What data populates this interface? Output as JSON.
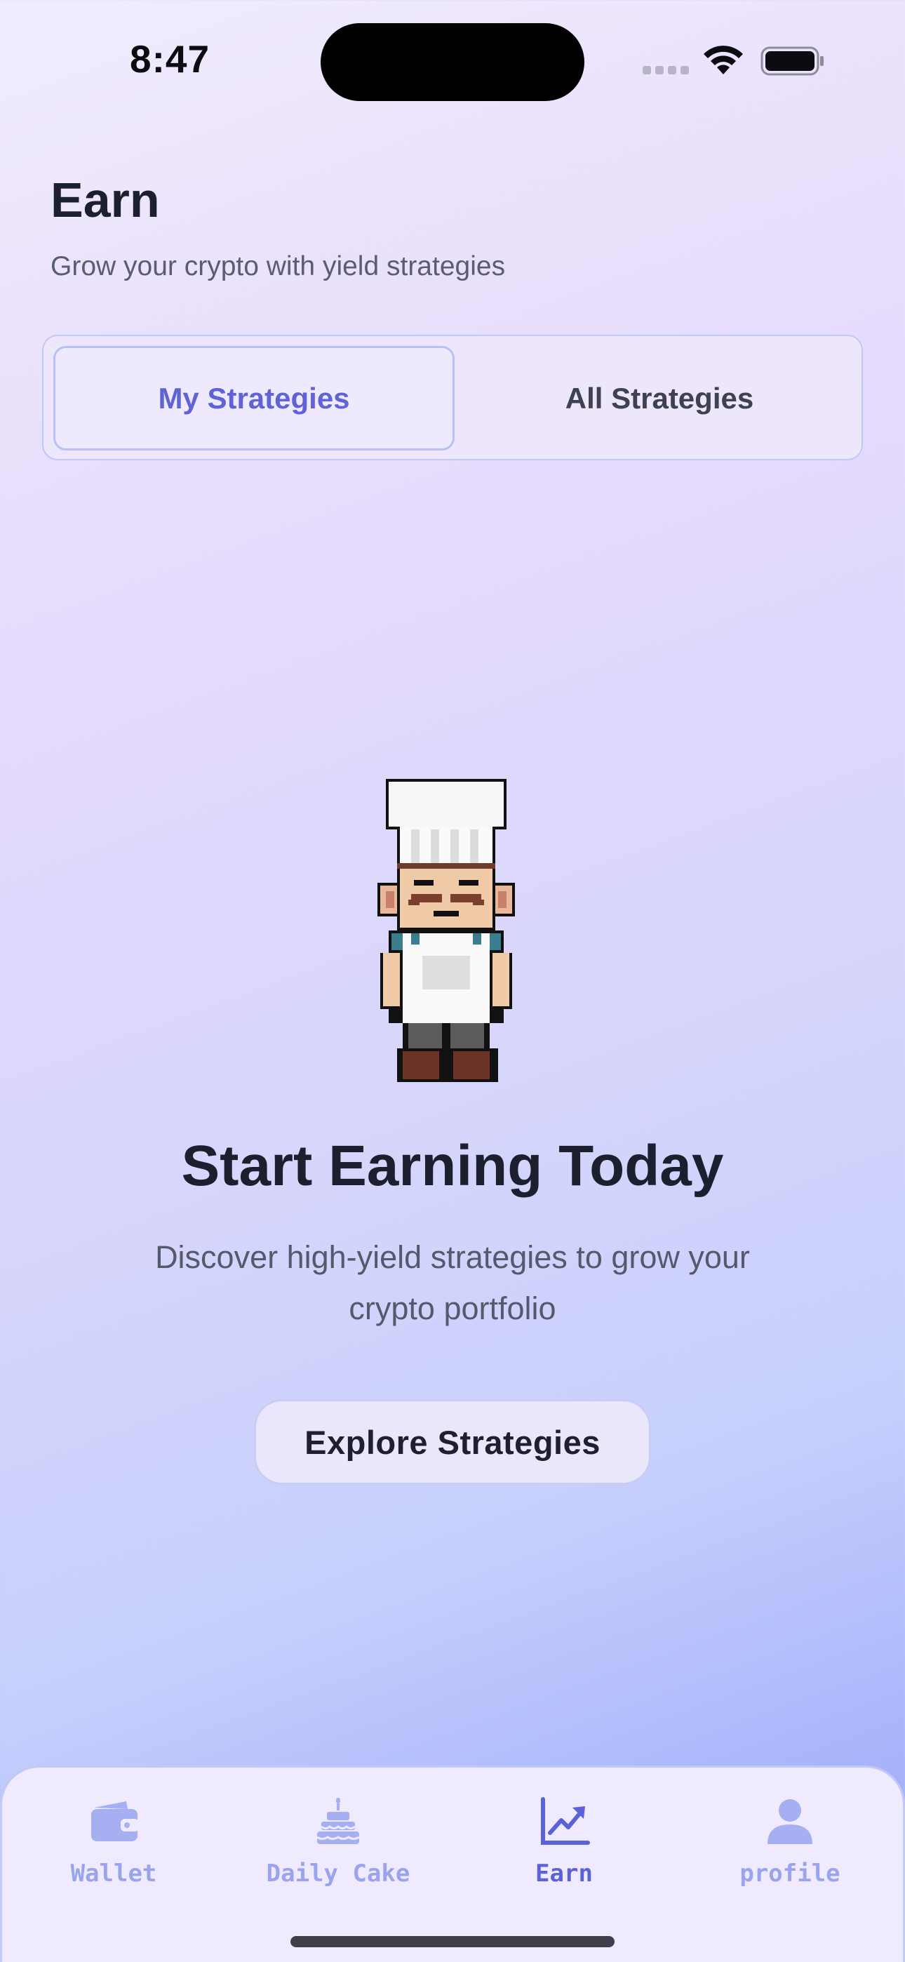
{
  "status_bar": {
    "time": "8:47"
  },
  "header": {
    "title": "Earn",
    "subtitle": "Grow your crypto with yield strategies"
  },
  "segments": {
    "my_strategies": "My Strategies",
    "all_strategies": "All Strategies",
    "selected": "My Strategies"
  },
  "empty_state": {
    "illustration": "pixel-chef-icon",
    "title": "Start Earning Today",
    "description": "Discover high-yield strategies to grow your crypto portfolio",
    "button_label": "Explore Strategies"
  },
  "tab_bar": {
    "items": [
      {
        "label": "Wallet",
        "icon": "wallet-icon"
      },
      {
        "label": "Daily Cake",
        "icon": "cake-icon"
      },
      {
        "label": "Earn",
        "icon": "chart-trend-icon"
      },
      {
        "label": "profile",
        "icon": "user-icon"
      }
    ],
    "active": "Earn"
  },
  "colors": {
    "accent": "#5f63d6",
    "inactive_tab": "#9aa4ee",
    "title_text": "#1c1f2e"
  }
}
